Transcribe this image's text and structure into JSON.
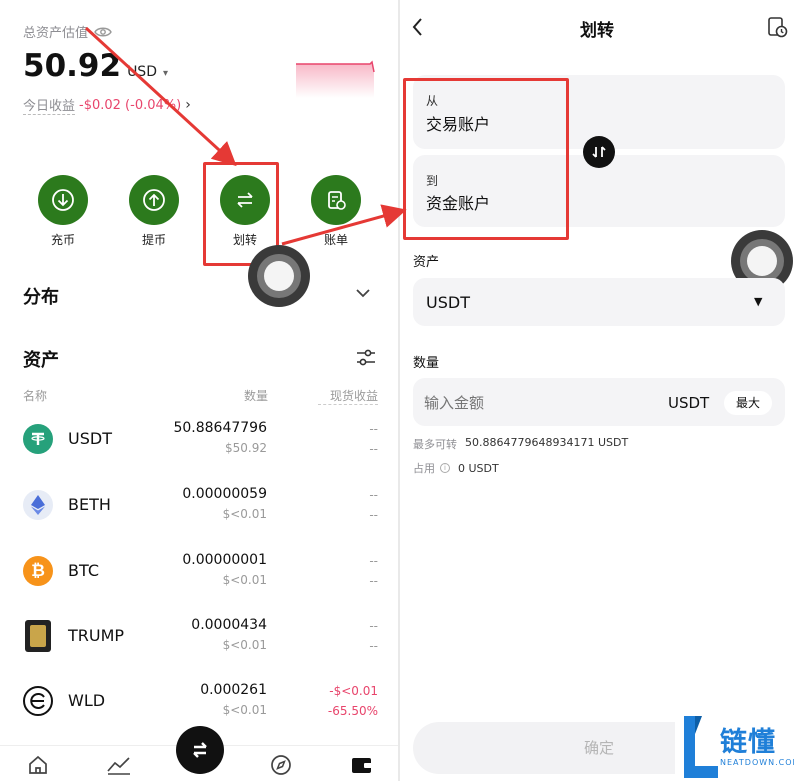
{
  "left": {
    "total_label": "总资产估值",
    "total_value": "50.92",
    "currency": "USD",
    "pnl_label": "今日收益",
    "pnl_value": "-$0.02 (-0.04%)",
    "actions": [
      {
        "label": "充币",
        "icon": "deposit-icon"
      },
      {
        "label": "提币",
        "icon": "withdraw-icon"
      },
      {
        "label": "划转",
        "icon": "transfer-icon"
      },
      {
        "label": "账单",
        "icon": "bill-icon"
      }
    ],
    "distribution_label": "分布",
    "assets_label": "资产",
    "columns": {
      "name": "名称",
      "qty": "数量",
      "pnl": "现货收益"
    },
    "assets": [
      {
        "name": "USDT",
        "qty": "50.88647796",
        "usd": "$50.92",
        "pnl1": "--",
        "pnl2": "--",
        "icon": "usdt-icon",
        "color": "#26a17b"
      },
      {
        "name": "BETH",
        "qty": "0.00000059",
        "usd": "$<0.01",
        "pnl1": "--",
        "pnl2": "--",
        "icon": "eth-icon",
        "color": "#e7ecf6"
      },
      {
        "name": "BTC",
        "qty": "0.00000001",
        "usd": "$<0.01",
        "pnl1": "--",
        "pnl2": "--",
        "icon": "btc-icon",
        "color": "#f7931a"
      },
      {
        "name": "TRUMP",
        "qty": "0.0000434",
        "usd": "$<0.01",
        "pnl1": "--",
        "pnl2": "--",
        "icon": "trump-icon",
        "color": "#222222"
      },
      {
        "name": "WLD",
        "qty": "0.000261",
        "usd": "$<0.01",
        "pnl1": "-$<0.01",
        "pnl2": "-65.50%",
        "icon": "wld-icon",
        "color": "#ffffff"
      }
    ]
  },
  "right": {
    "title": "划转",
    "from_label": "从",
    "from_account": "交易账户",
    "to_label": "到",
    "to_account": "资金账户",
    "asset_label": "资产",
    "asset_value": "USDT",
    "qty_label": "数量",
    "amount_placeholder": "输入金额",
    "amount_unit": "USDT",
    "max_label": "最大",
    "max_available_label": "最多可转",
    "max_available_value": "50.8864779648934171 USDT",
    "occupied_label": "占用",
    "occupied_value": "0 USDT",
    "confirm_label": "确定"
  },
  "watermark": {
    "brand": "链懂",
    "domain": "NEATDOWN.COM"
  },
  "colors": {
    "accent_green": "#2c7a1d",
    "annotation_red": "#e53935",
    "loss_red": "#e8456c"
  }
}
